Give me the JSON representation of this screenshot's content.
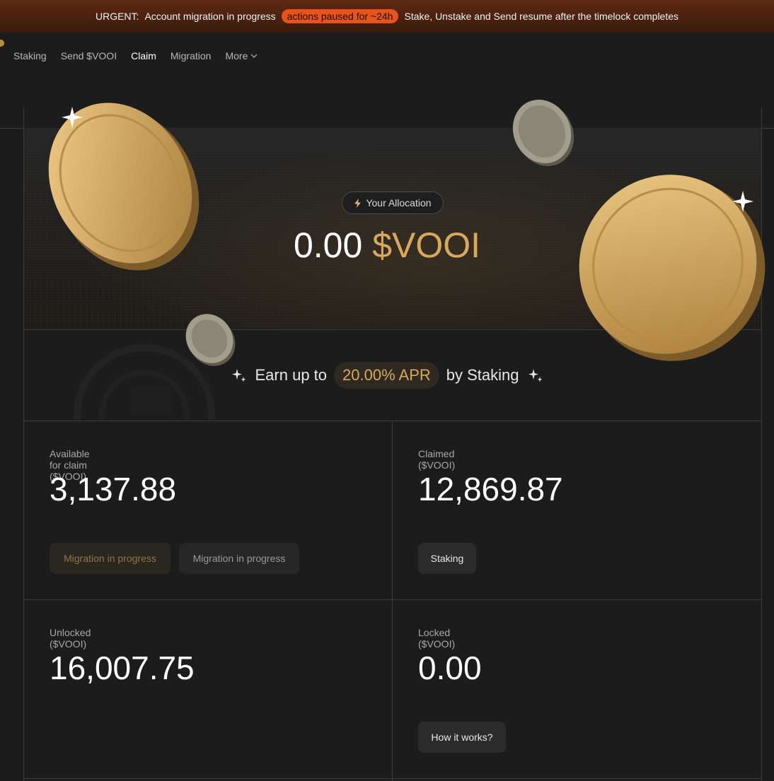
{
  "banner": {
    "urgent_label": "URGENT:",
    "message": "Account migration in progress",
    "pill": "actions paused for ~24h",
    "detail": "Stake, Unstake and Send resume after the timelock completes",
    "pill_color": "#e8531c"
  },
  "nav": {
    "items": [
      {
        "label": "Staking"
      },
      {
        "label": "Send $VOOI"
      },
      {
        "label": "Claim"
      },
      {
        "label": "Migration"
      },
      {
        "label": "More"
      }
    ],
    "active": "Claim",
    "more_icon": "chevron-down-icon"
  },
  "hero": {
    "pill_icon": "lightning-icon",
    "pill_label": "Your Allocation",
    "amount": "0.00",
    "token": "$VOOI",
    "token_color": "#d9a85e"
  },
  "earn": {
    "prefix": "Earn up to",
    "apr": "20.00% APR",
    "suffix": "by Staking",
    "sparkle_icon": "sparkle-icon"
  },
  "stats": {
    "available": {
      "label": "Available for claim ($VOOI)",
      "value": "3,137.88",
      "buttons": [
        "Migration in progress",
        "Migration in progress"
      ]
    },
    "claimed": {
      "label": "Claimed ($VOOI)",
      "value": "12,869.87",
      "button": "Staking"
    },
    "unlocked": {
      "label": "Unlocked ($VOOI)",
      "value": "16,007.75"
    },
    "locked": {
      "label": "Locked ($VOOI)",
      "value": "0.00",
      "button": "How it works?"
    }
  },
  "colors": {
    "background": "#1c1c1c",
    "accent_gold": "#d9a85e",
    "banner_bg": "#5e2a12"
  }
}
